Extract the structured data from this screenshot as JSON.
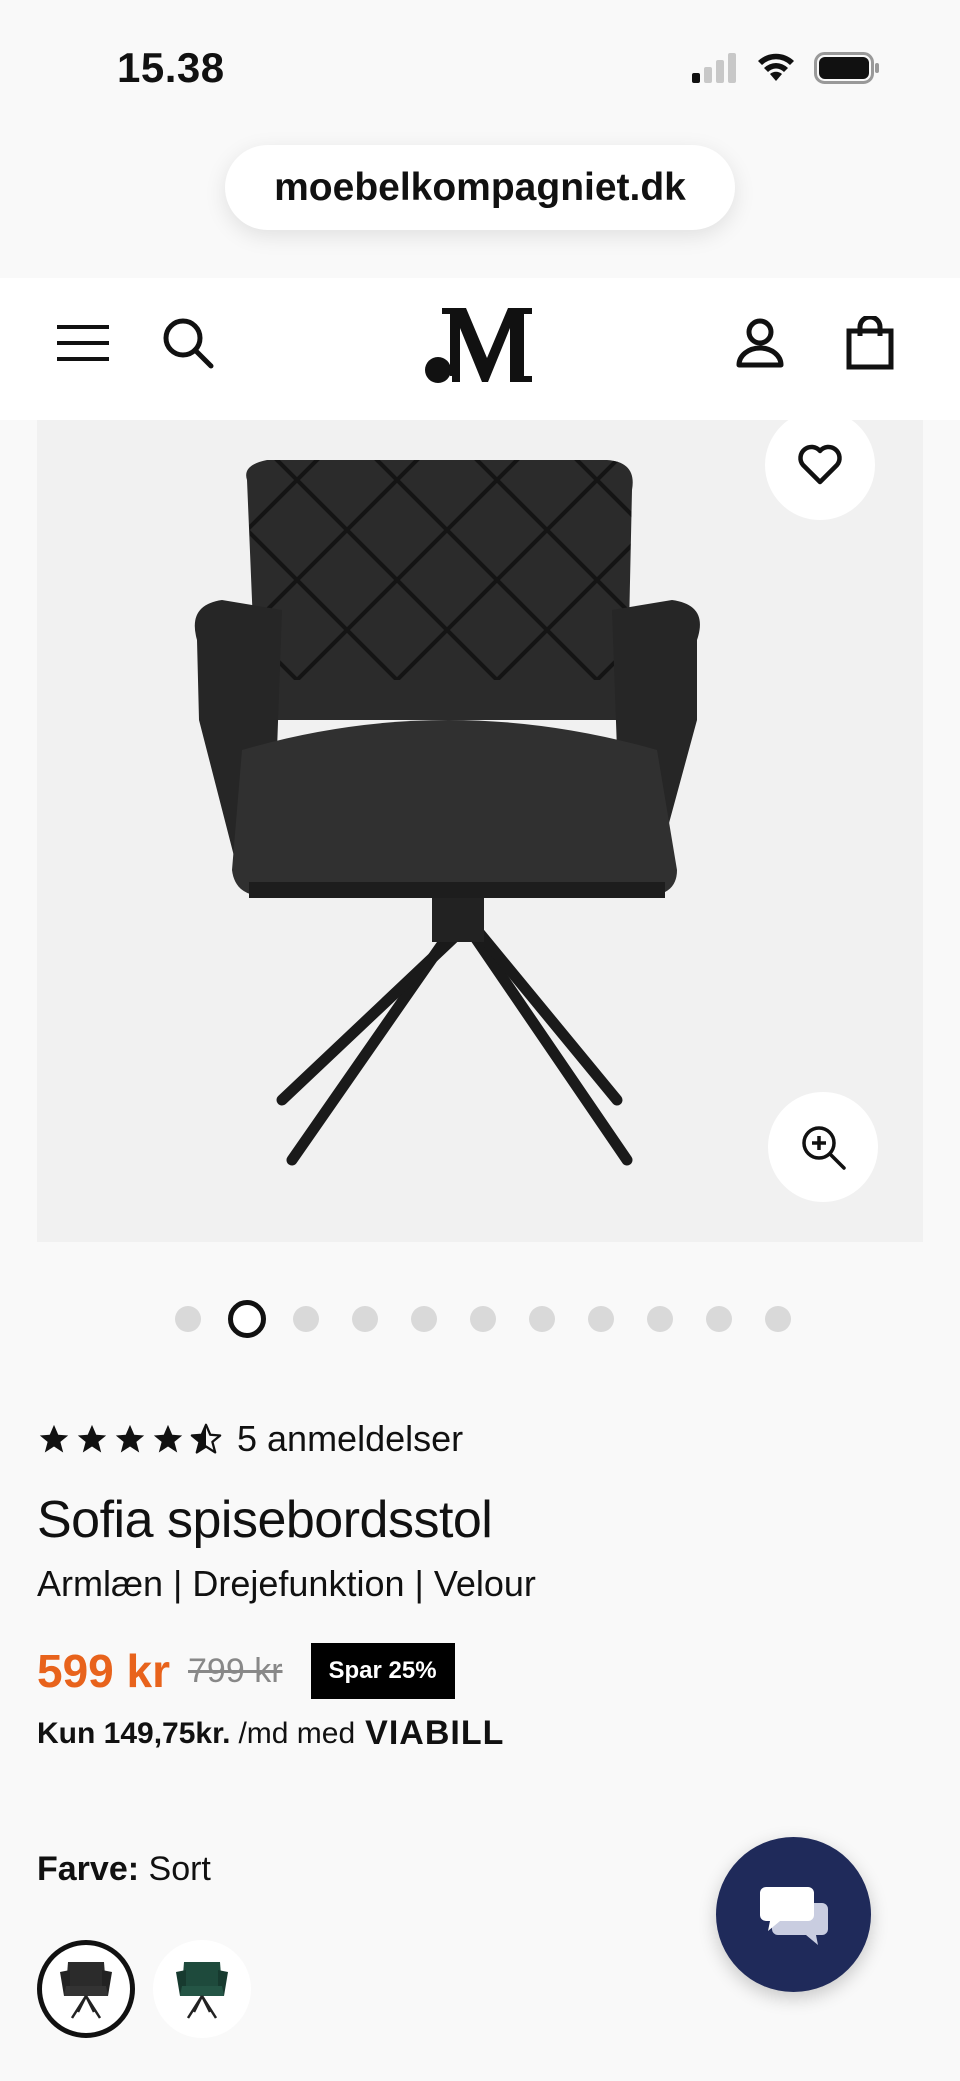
{
  "status_bar": {
    "time": "15.38"
  },
  "browser": {
    "url": "moebelkompagniet.dk"
  },
  "header": {
    "logo_text": ".M"
  },
  "gallery": {
    "total_images": 11,
    "active_index": 1
  },
  "product": {
    "rating": 4.5,
    "reviews_label": "5 anmeldelser",
    "title": "Sofia spisebordsstol",
    "subtitle": "Armlæn | Drejefunktion | Velour",
    "price": "599 kr",
    "old_price": "799 kr",
    "save_badge": "Spar 25%",
    "financing_amount": "Kun 149,75kr.",
    "financing_suffix": "/md med",
    "financing_provider": "VIABILL"
  },
  "color_selector": {
    "label": "Farve:",
    "value": "Sort",
    "swatches": [
      {
        "name": "Sort",
        "selected": true
      },
      {
        "name": "Grøn",
        "selected": false
      }
    ]
  },
  "colors": {
    "price_accent": "#e8631c",
    "chat_button": "#1f2a5a",
    "green_swatch": "#1e4a3c"
  }
}
